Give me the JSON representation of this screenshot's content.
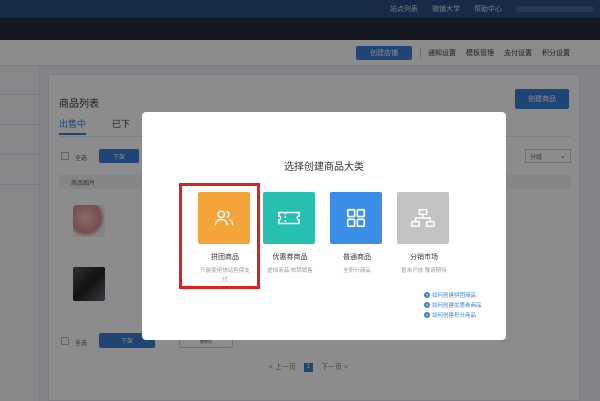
{
  "topbar": {
    "links": [
      "站点列表",
      "微铺大学",
      "帮助中心"
    ]
  },
  "settings_bar": {
    "create_shop": "创建店铺",
    "nav": [
      "通知设置",
      "模板管理",
      "支付设置",
      "积分设置"
    ]
  },
  "panel": {
    "title": "商品列表",
    "create_product": "创建商品",
    "tabs": [
      {
        "label": "出售中",
        "active": true
      },
      {
        "label": "已下",
        "active": false
      }
    ],
    "select_all": "全选",
    "offshelf_btn": "下架",
    "select_placeholder": "分组",
    "table_header": "商品图片",
    "bottom_select_all": "全选",
    "bottom_offshelf": "下架",
    "bottom_delete": "删除",
    "pager": {
      "prev": "< 上一页",
      "current": "1",
      "next": "下一页 >"
    }
  },
  "modal": {
    "title": "选择创建商品大类",
    "categories": [
      {
        "name": "拼团商品",
        "desc": "只能使用快站担保支付",
        "color": "#f5a43a",
        "icon": "users-icon"
      },
      {
        "name": "优惠券商品",
        "desc": "虚拟商品 核销销售",
        "color": "#27c0b0",
        "icon": "ticket-icon"
      },
      {
        "name": "普通商品",
        "desc": "全积分商品",
        "color": "#3a8ee8",
        "icon": "grid-icon"
      },
      {
        "name": "分销市场",
        "desc": "暂未开放 敬请期待",
        "color": "#c3c3c3",
        "icon": "sitemap-icon"
      }
    ],
    "help_links": [
      "如何创建拼团商品",
      "如何创建优惠券商品",
      "如何创建积分商品"
    ]
  },
  "colors": {
    "accent": "#3a7fd5",
    "highlight": "#e01f1f"
  }
}
